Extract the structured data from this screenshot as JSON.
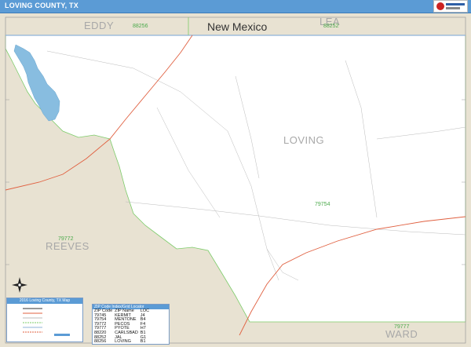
{
  "title": "LOVING COUNTY, TX",
  "labels": {
    "eddy": "EDDY",
    "lea": "LEA",
    "new_mexico": "New Mexico",
    "loving": "LOVING",
    "reeves": "REEVES",
    "ward": "WARD"
  },
  "zip_codes": {
    "eddy_zip": "88256",
    "lea_zip": "88252",
    "loving_zip": "79754",
    "reeves_zip": "79772",
    "ward_zip": "79777"
  },
  "legend": {
    "title": "2016 Loving County, TX Map"
  },
  "zip_index": {
    "title": "ZIP Code Index/Grid Locator",
    "headers": [
      "ZIP Code",
      "ZIP Name",
      "LOC"
    ],
    "rows": [
      [
        "79745",
        "KERMIT",
        "J4"
      ],
      [
        "79754",
        "MENTONE",
        "B4"
      ],
      [
        "79772",
        "PECOS",
        "F4"
      ],
      [
        "79777",
        "PYOTE",
        "H7"
      ],
      [
        "88220",
        "CARLSBAD",
        "B1"
      ],
      [
        "88252",
        "JAL",
        "G1"
      ],
      [
        "88256",
        "LOVING",
        "B1"
      ]
    ]
  },
  "colors": {
    "title_bar": "#5b9bd5",
    "surrounding_land": "#e8e2d2",
    "county_land": "#ffffff",
    "water": "#88bde0",
    "highway": "#e06040",
    "zip_boundary": "#7dcc6a",
    "road": "#bbbbbb"
  },
  "icons": {
    "north_arrow": "compass-rose-icon",
    "logo": "publisher-logo-icon"
  }
}
